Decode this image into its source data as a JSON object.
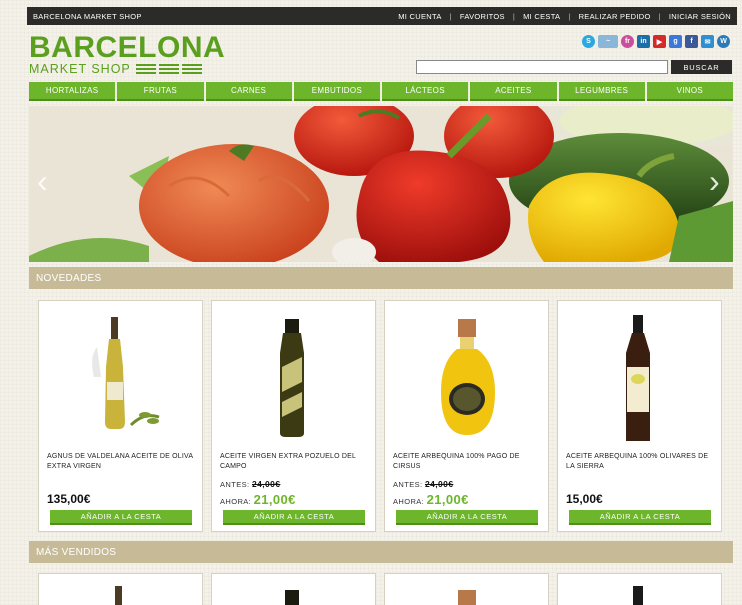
{
  "topbar": {
    "brand": "BARCELONA MARKET SHOP",
    "links": [
      "MI CUENTA",
      "FAVORITOS",
      "MI CESTA",
      "REALIZAR PEDIDO",
      "INICIAR SESIÓN"
    ]
  },
  "logo": {
    "line1": "BARCELONA",
    "line2": "MARKET SHOP"
  },
  "social": [
    {
      "icon": "skype-icon",
      "glyph": "S",
      "color": "#2aa9e0"
    },
    {
      "icon": "rss-icon",
      "glyph": "~",
      "color": "#8ab7d9"
    },
    {
      "icon": "flickr-icon",
      "glyph": "fr",
      "color": "#c94f9a"
    },
    {
      "icon": "linkedin-icon",
      "glyph": "in",
      "color": "#1b6ea8"
    },
    {
      "icon": "youtube-icon",
      "glyph": "▶",
      "color": "#d32a2a"
    },
    {
      "icon": "google-plus-icon",
      "glyph": "g",
      "color": "#3b78d8"
    },
    {
      "icon": "facebook-icon",
      "glyph": "f",
      "color": "#3b5998"
    },
    {
      "icon": "email-icon",
      "glyph": "✉",
      "color": "#2f8fd1"
    },
    {
      "icon": "wordpress-icon",
      "glyph": "W",
      "color": "#2b7bb9"
    }
  ],
  "search": {
    "value": "",
    "button": "BUSCAR"
  },
  "nav": [
    "HORTALIZAS",
    "FRUTAS",
    "CARNES",
    "EMBUTIDOS",
    "LÁCTEOS",
    "ACEITES",
    "LEGUMBRES",
    "VINOS"
  ],
  "sections": {
    "novedades": "NOVEDADES",
    "mas_vendidos": "MÁS VENDIDOS"
  },
  "products": [
    {
      "name": "AGNUS DE VALDELANA ACEITE DE OLIVA EXTRA VIRGEN",
      "price": "135,00€",
      "add": "AÑADIR A LA CESTA"
    },
    {
      "name": "ACEITE VIRGEN EXTRA POZUELO DEL CAMPO",
      "antes_label": "ANTES:",
      "antes": "24,00€",
      "ahora_label": "AHORA:",
      "ahora": "21,00€",
      "add": "AÑADIR A LA CESTA"
    },
    {
      "name": "ACEITE ARBEQUINA 100% PAGO DE CIRSUS",
      "antes_label": "ANTES:",
      "antes": "24,00€",
      "ahora_label": "AHORA:",
      "ahora": "21,00€",
      "add": "AÑADIR A LA CESTA"
    },
    {
      "name": "ACEITE ARBEQUINA 100% OLIVARES DE LA SIERRA",
      "price": "15,00€",
      "add": "AÑADIR A LA CESTA"
    }
  ],
  "colors": {
    "green": "#6db52a",
    "dark": "#2c2b29",
    "section": "#c7bb97"
  }
}
